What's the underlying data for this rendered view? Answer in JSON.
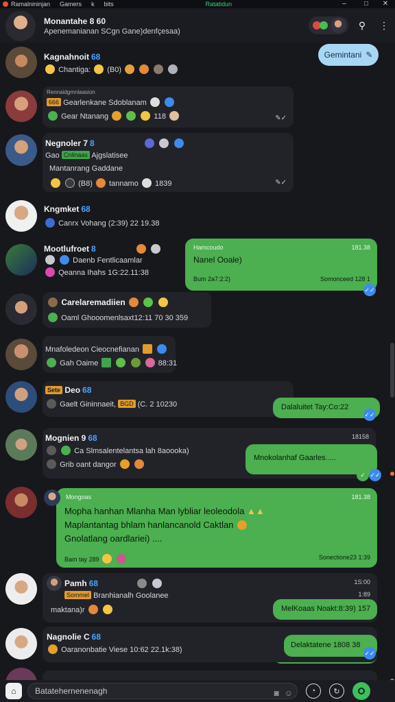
{
  "titlebar": {
    "app_name": "Ramalnininjan",
    "menu": [
      "Gamers",
      "k",
      "bits"
    ],
    "status": "Ratatidun"
  },
  "header": {
    "title": "Monantahe 8 60",
    "subtitle": "Apenemanianan SCgn Gane)denfçesaa)"
  },
  "pinned_pill": {
    "label": "Gemintani"
  },
  "chats": [
    {
      "name": "Kagnahnoit",
      "tag": "68",
      "line1": "Chantiga:",
      "line2": "(B0)"
    },
    {
      "head": "Rennaidgmnlaasion",
      "tagbox": "666",
      "line1": "Gearlenkane Sdoblanam",
      "line2": "Gear Ntanang",
      "val": "118"
    },
    {
      "name": "Negnoler 7",
      "tag": "8",
      "tagbox": "Cnlinaas",
      "line1": "Gao",
      "line1b": "Ajgslatisee",
      "line2": "Mantanrang Gaddane",
      "line3a": "(B8)",
      "line3b": "tannamo",
      "line3c": "1839"
    },
    {
      "name": "Kngmket",
      "tag": "68",
      "line1": "Canrx Vohang (2:39) 22 19.38"
    },
    {
      "name": "Mootlufroet",
      "tag": "8",
      "line1": "Daenb Fentlicaamlar",
      "line2": "Qeanna Ihahs 1G:22.11:38",
      "reply": {
        "top": "Hamcoudo",
        "time": "181.38",
        "main": "Nanel Ooale)",
        "foot_left": "Bum 2a7:2:2)",
        "foot_right": "Somonceed 128 1"
      }
    },
    {
      "name": "Carelaremadiien",
      "line1": "Oaml Ghooomenlsaxt12:11 70 30 359"
    },
    {
      "head": "Mnafoledeon Cieocnefianan",
      "line1": "Gah Oaime",
      "val": "88:31"
    },
    {
      "name": "Deo",
      "tag": "68",
      "tagbox": "Sete",
      "line1": "Gaelt Gininnaeit,",
      "tagbox2": "BGD",
      "line1b": "(C. 2 10230",
      "reply": {
        "main": "Dalaluitet  Tay:Co:22"
      }
    },
    {
      "name": "Mognien 9",
      "tag": "68",
      "line1": "Ca  Slmsalentelantsa lah 8aoooka)",
      "line2": "Grib oant dangor",
      "reply": {
        "time": "18158",
        "main": "Mnokolanhaf Gaarles....."
      }
    },
    {
      "reply": {
        "top": "Mongoas",
        "time": "181.38",
        "main1": "Mopha hanhan Mlanha Man lybliar leoleodola",
        "main2": "Maplantantag bhlam hanlancanold Caktlan",
        "main3": "Gnolatlang oardlariei) ....",
        "foot_left": "Bam tay 289",
        "foot_right": "Sonectione23 1:39"
      }
    },
    {
      "name": "Pamh",
      "tag": "68",
      "tagbox": "Sommel",
      "line1": "Branhianalh Goolanee",
      "line2": "maktana)r",
      "reply": {
        "time": "1S:00",
        "time2": "1:89",
        "main": "MelKoaas Noakt:8:39) 157"
      }
    },
    {
      "name": "Nagnolie C",
      "tag": "68",
      "line1": "Oaranonbatie Viese 10:62 22.1k:38)",
      "reply": {
        "main": "Delaktatene 1808 38"
      }
    }
  ],
  "composer": {
    "placeholder": "Batatehernenenagh"
  },
  "colors": {
    "bg": "#17181c",
    "bubble_in": "#222329",
    "bubble_out": "#4caf50",
    "accent_blue": "#3d8bf0",
    "pill": "#a8d7f5"
  }
}
